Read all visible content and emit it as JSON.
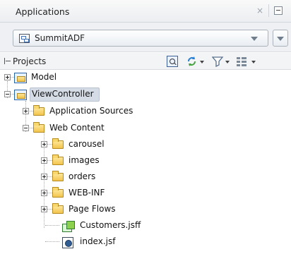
{
  "panel": {
    "title": "Applications",
    "close_glyph": "×"
  },
  "application_selector": {
    "selected": "SummitADF"
  },
  "projects": {
    "title": "Projects",
    "icons": [
      "find-icon",
      "sync-icon",
      "filter-icon",
      "layout-icon"
    ]
  },
  "tree": {
    "model": "Model",
    "view_controller": "ViewController",
    "application_sources": "Application Sources",
    "web_content": "Web Content",
    "carousel": "carousel",
    "images": "images",
    "orders": "orders",
    "web_inf": "WEB-INF",
    "page_flows": "Page Flows",
    "customers_jsff": "Customers.jsff",
    "index_jsf": "index.jsf"
  }
}
